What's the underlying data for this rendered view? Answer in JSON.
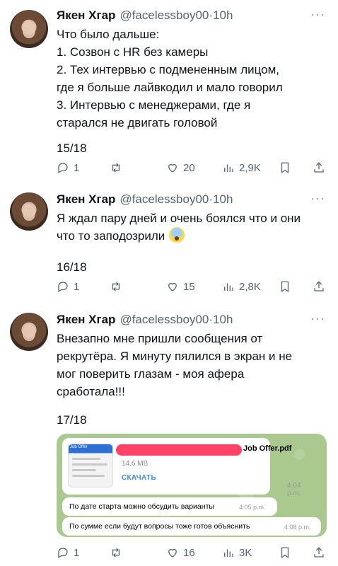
{
  "tweets": [
    {
      "name": "Якен Хгар",
      "handle": "@facelessboy00",
      "time": "10h",
      "lines": [
        "Что было дальше:",
        "1. Созвон с HR без камеры",
        "2. Тех интервью с подмененным лицом,",
        "где я больше лайвкодил и мало говорил",
        "3. Интервью с менеджерами, где я",
        "старался не двигать головой"
      ],
      "counter": "15/18",
      "replies": "1",
      "retweets": "",
      "likes": "20",
      "views": "2,9K"
    },
    {
      "name": "Якен Хгар",
      "handle": "@facelessboy00",
      "time": "10h",
      "lines": [
        "Я ждал пару дней и очень боялся что и они",
        "что то заподозрили"
      ],
      "counter": "16/18",
      "replies": "1",
      "retweets": "",
      "likes": "15",
      "views": "2,8K"
    },
    {
      "name": "Якен Хгар",
      "handle": "@facelessboy00",
      "time": "10h",
      "lines": [
        "Внезапно мне пришли сообщения от",
        "рекрутёра. Я минуту пялился в экран и не",
        "мог поверить глазам - моя афера",
        "сработала!!!"
      ],
      "counter": "17/18",
      "replies": "1",
      "retweets": "",
      "likes": "16",
      "views": "3K"
    }
  ],
  "embed": {
    "thumb_label": "Job Offer",
    "file_name": "Job Offer.pdf",
    "file_size": "14.6 MB",
    "download_label": "СКАЧАТЬ",
    "file_time": "4:04 p.m.",
    "messages": [
      {
        "text": "По дате старта можно обсудить варианты",
        "time": "4:05 p.m."
      },
      {
        "text": "По сумме если будут вопросы тоже готов объяснить",
        "time": "4:08 p.m."
      }
    ]
  },
  "separator": "·",
  "more_label": "···",
  "colors": {
    "text": "#0f1419",
    "muted": "#536471",
    "redact": "#ff2d55",
    "chat_bg": "#a9c98f"
  }
}
